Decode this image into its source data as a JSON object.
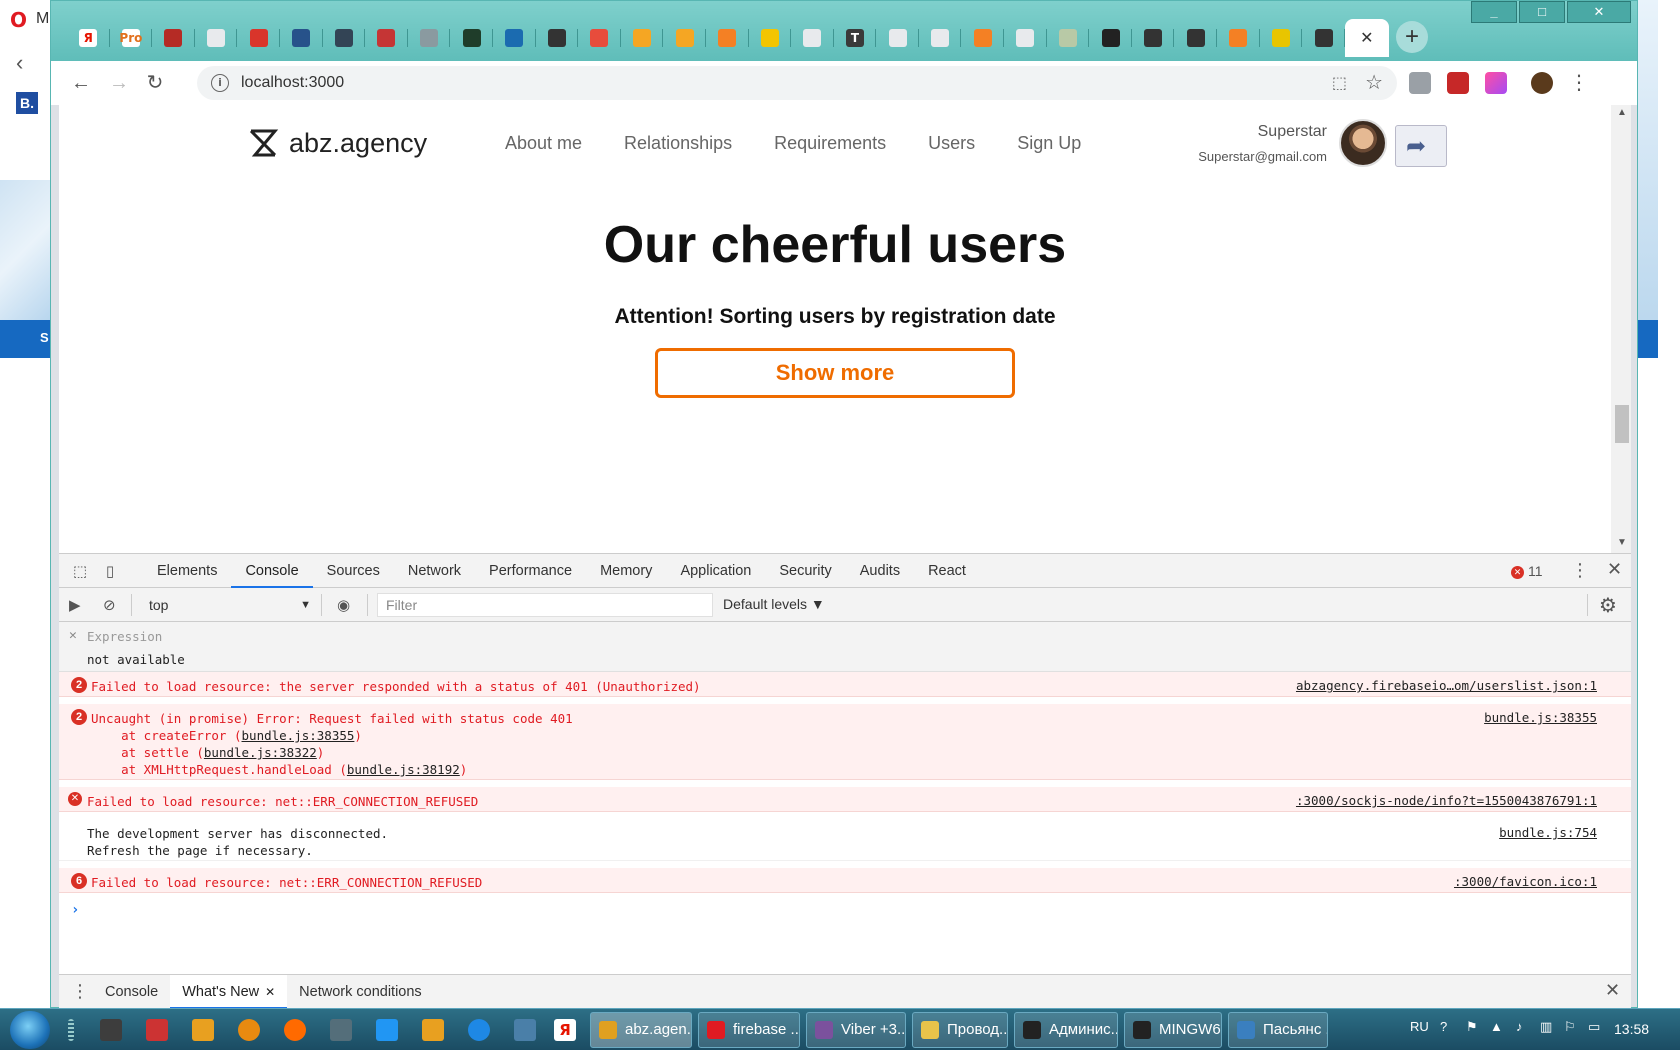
{
  "bg_window": {
    "opera_letter": "O",
    "top_letter": "M",
    "b_letter": "B.",
    "bar_letter": "S"
  },
  "tabs": [
    {
      "icon": "yandex-icon",
      "label": "Я",
      "color": "#ffffff",
      "fg": "#e61400"
    },
    {
      "icon": "pro-icon",
      "label": "Pro",
      "color": "#ffffff",
      "fg": "#e2701d"
    },
    {
      "icon": "record-icon",
      "label": "",
      "color": "#b52b25"
    },
    {
      "icon": "page-icon",
      "label": "",
      "color": "#e8eaed"
    },
    {
      "icon": "opera-icon",
      "label": "",
      "color": "#d9352b"
    },
    {
      "icon": "chart-icon",
      "label": "",
      "color": "#27528a"
    },
    {
      "icon": "cat-icon",
      "label": "",
      "color": "#334455"
    },
    {
      "icon": "angular-icon",
      "label": "",
      "color": "#c53535"
    },
    {
      "icon": "cart-icon",
      "label": "",
      "color": "#8a9aa0"
    },
    {
      "icon": "leaf-icon",
      "label": "",
      "color": "#1f3d2a"
    },
    {
      "icon": "hourglass-icon",
      "label": "",
      "color": "#1b6bb0"
    },
    {
      "icon": "glasses-icon",
      "label": "",
      "color": "#333333"
    },
    {
      "icon": "hacker-icon",
      "label": "",
      "color": "#e74c3c"
    },
    {
      "icon": "firebase-icon",
      "label": "",
      "color": "#f5a623"
    },
    {
      "icon": "firebase-icon",
      "label": "",
      "color": "#f5a623"
    },
    {
      "icon": "stackoverflow-icon",
      "label": "",
      "color": "#f48024"
    },
    {
      "icon": "play-icon",
      "label": "",
      "color": "#f3c500"
    },
    {
      "icon": "page-icon",
      "label": "",
      "color": "#e8eaed"
    },
    {
      "icon": "t-icon",
      "label": "T",
      "color": "#3a3a3a"
    },
    {
      "icon": "page-icon",
      "label": "",
      "color": "#e8eaed"
    },
    {
      "icon": "page-icon",
      "label": "",
      "color": "#e8eaed"
    },
    {
      "icon": "stackoverflow-icon",
      "label": "",
      "color": "#f48024"
    },
    {
      "icon": "page-icon",
      "label": "",
      "color": "#e8eaed"
    },
    {
      "icon": "bulb-icon",
      "label": "",
      "color": "#b8c9a6"
    },
    {
      "icon": "github-icon",
      "label": "",
      "color": "#222222"
    },
    {
      "icon": "glasses-icon",
      "label": "",
      "color": "#333333"
    },
    {
      "icon": "glasses-icon",
      "label": "",
      "color": "#333333"
    },
    {
      "icon": "stackoverflow-icon",
      "label": "",
      "color": "#f48024"
    },
    {
      "icon": "grid-icon",
      "label": "",
      "color": "#e8c500"
    },
    {
      "icon": "glasses-icon",
      "label": "",
      "color": "#333333"
    }
  ],
  "active_tab_close": "✕",
  "new_tab": "+",
  "window_controls": {
    "minimize": "_",
    "maximize": "□",
    "close": "✕"
  },
  "toolbar": {
    "url": "localhost:3000",
    "info_glyph": "i"
  },
  "site": {
    "logo_text": "abz.agency",
    "nav": [
      "About me",
      "Relationships",
      "Requirements",
      "Users",
      "Sign Up"
    ],
    "user_name": "Superstar",
    "user_email": "Superstar@gmail.com",
    "title": "Our cheerful users",
    "subtitle": "Attention! Sorting users by registration date",
    "show_more": "Show more"
  },
  "devtools": {
    "tabs": [
      "Elements",
      "Console",
      "Sources",
      "Network",
      "Performance",
      "Memory",
      "Application",
      "Security",
      "Audits",
      "React"
    ],
    "active_tab": "Console",
    "error_count": "11",
    "context": "top",
    "filter_placeholder": "Filter",
    "levels": "Default levels ▼",
    "expression_label": "Expression",
    "expression_value": "not available",
    "messages": [
      {
        "type": "err",
        "count": "2",
        "text": "Failed to load resource: the server responded with a status of 401 (Unauthorized)",
        "source": "abzagency.firebaseio…om/userslist.json:1"
      },
      {
        "type": "err",
        "count": "2",
        "text": "Uncaught (in promise) Error: Request failed with status code 401",
        "source": "bundle.js:38355",
        "stack": [
          {
            "pre": "    at createError (",
            "link": "bundle.js:38355",
            "post": ")"
          },
          {
            "pre": "    at settle (",
            "link": "bundle.js:38322",
            "post": ")"
          },
          {
            "pre": "    at XMLHttpRequest.handleLoad (",
            "link": "bundle.js:38192",
            "post": ")"
          }
        ]
      },
      {
        "type": "err",
        "count": "",
        "text": "Failed to load resource: net::ERR_CONNECTION_REFUSED",
        "source": ":3000/sockjs-node/info?t=1550043876791:1"
      },
      {
        "type": "info",
        "count": "",
        "text": "The development server has disconnected.\nRefresh the page if necessary.",
        "source": "bundle.js:754"
      },
      {
        "type": "err",
        "count": "6",
        "text": "Failed to load resource: net::ERR_CONNECTION_REFUSED",
        "source": ":3000/favicon.ico:1"
      }
    ],
    "prompt": "›",
    "drawer_tabs": [
      "Console",
      "What's New",
      "Network conditions"
    ],
    "drawer_active": "What's New",
    "drawer_tab_close": "✕"
  },
  "taskbar": {
    "buttons": [
      {
        "label": "abz.agen...",
        "icon": "chrome-icon",
        "color": "#e0a020",
        "active": true
      },
      {
        "label": "firebase ...",
        "icon": "opera-icon",
        "color": "#e01b22",
        "active": false
      },
      {
        "label": "Viber +3...",
        "icon": "viber-icon",
        "color": "#7b519d",
        "active": false
      },
      {
        "label": "Провод...",
        "icon": "folder-icon",
        "color": "#e8c34a",
        "active": false
      },
      {
        "label": "Админис...",
        "icon": "cmd-icon",
        "color": "#222222",
        "active": false
      },
      {
        "label": "MINGW6...",
        "icon": "cmd-icon",
        "color": "#222222",
        "active": false
      },
      {
        "label": "Пасьянс ...",
        "icon": "cards-icon",
        "color": "#3a7fbf",
        "active": false
      }
    ],
    "lang": "RU",
    "time": "13:58"
  }
}
